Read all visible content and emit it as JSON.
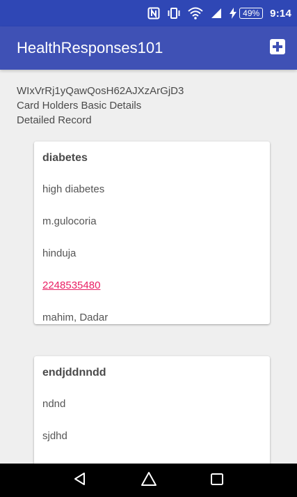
{
  "status_bar": {
    "battery_level": "49%",
    "time": "9:14",
    "icons": [
      "nfc-icon",
      "vibrate-icon",
      "wifi-icon",
      "signal-icon",
      "charging-icon"
    ]
  },
  "app_bar": {
    "title": "HealthResponses101",
    "action_icon": "add-box-icon"
  },
  "header": {
    "record_id": "WIxVrRj1yQawQosH62AJXzArGjD3",
    "subtitle": "Card Holders Basic Details",
    "section": "Detailed Record"
  },
  "records": [
    {
      "title": "diabetes",
      "detail": "high diabetes",
      "medicine": "m.gulocoria",
      "hospital": "hinduja",
      "phone": "2248535480",
      "address": "mahim, Dadar"
    },
    {
      "title": "endjddnndd",
      "detail": "ndnd",
      "medicine": "sjdhd"
    }
  ],
  "nav_bar": {
    "items": [
      "back-icon",
      "home-icon",
      "recents-icon"
    ]
  },
  "colors": {
    "status_bar": "#2f47b5",
    "app_bar": "#3f51b5",
    "background": "#efefef",
    "link": "#e91e63",
    "nav_bar": "#000000"
  }
}
